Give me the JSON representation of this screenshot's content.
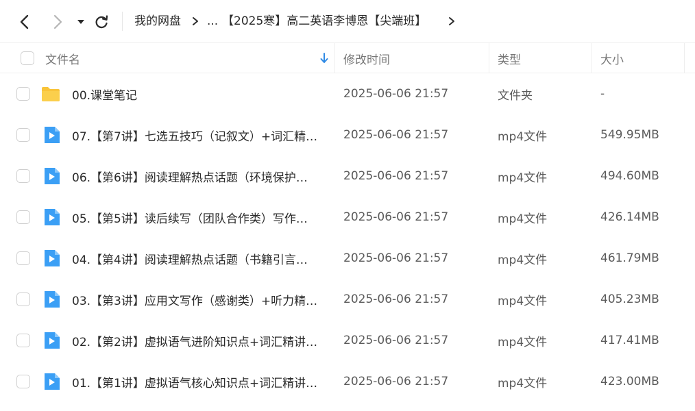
{
  "nav": {
    "back_icon": "chevron-left-icon",
    "forward_icon": "chevron-right-icon",
    "dropdown_icon": "caret-down-icon",
    "refresh_icon": "refresh-icon"
  },
  "breadcrumb": {
    "items": [
      "我的网盘",
      "...",
      "【2025寒】高二英语李博恩【尖端班】"
    ]
  },
  "columns": {
    "name": "文件名",
    "modified": "修改时间",
    "type": "类型",
    "size": "大小"
  },
  "files": [
    {
      "name": "00.课堂笔记",
      "modified": "2025-06-06 21:57",
      "type": "文件夹",
      "size": "-",
      "icon": "folder-icon"
    },
    {
      "name": "07.【第7讲】七选五技巧（记叙文）+词汇精…",
      "modified": "2025-06-06 21:57",
      "type": "mp4文件",
      "size": "549.95MB",
      "icon": "video-file-icon"
    },
    {
      "name": "06.【第6讲】阅读理解热点话题（环境保护…",
      "modified": "2025-06-06 21:57",
      "type": "mp4文件",
      "size": "494.60MB",
      "icon": "video-file-icon"
    },
    {
      "name": "05.【第5讲】读后续写（团队合作类）写作…",
      "modified": "2025-06-06 21:57",
      "type": "mp4文件",
      "size": "426.14MB",
      "icon": "video-file-icon"
    },
    {
      "name": "04.【第4讲】阅读理解热点话题（书籍引言…",
      "modified": "2025-06-06 21:57",
      "type": "mp4文件",
      "size": "461.79MB",
      "icon": "video-file-icon"
    },
    {
      "name": "03.【第3讲】应用文写作（感谢类）+听力精…",
      "modified": "2025-06-06 21:57",
      "type": "mp4文件",
      "size": "405.23MB",
      "icon": "video-file-icon"
    },
    {
      "name": "02.【第2讲】虚拟语气进阶知识点+词汇精讲…",
      "modified": "2025-06-06 21:57",
      "type": "mp4文件",
      "size": "417.41MB",
      "icon": "video-file-icon"
    },
    {
      "name": "01.【第1讲】虚拟语气核心知识点+词汇精讲…",
      "modified": "2025-06-06 21:57",
      "type": "mp4文件",
      "size": "423.00MB",
      "icon": "video-file-icon"
    }
  ],
  "colors": {
    "accent": "#2f8ae5",
    "folder": "#f9c43a",
    "video": "#3b9ff5"
  }
}
